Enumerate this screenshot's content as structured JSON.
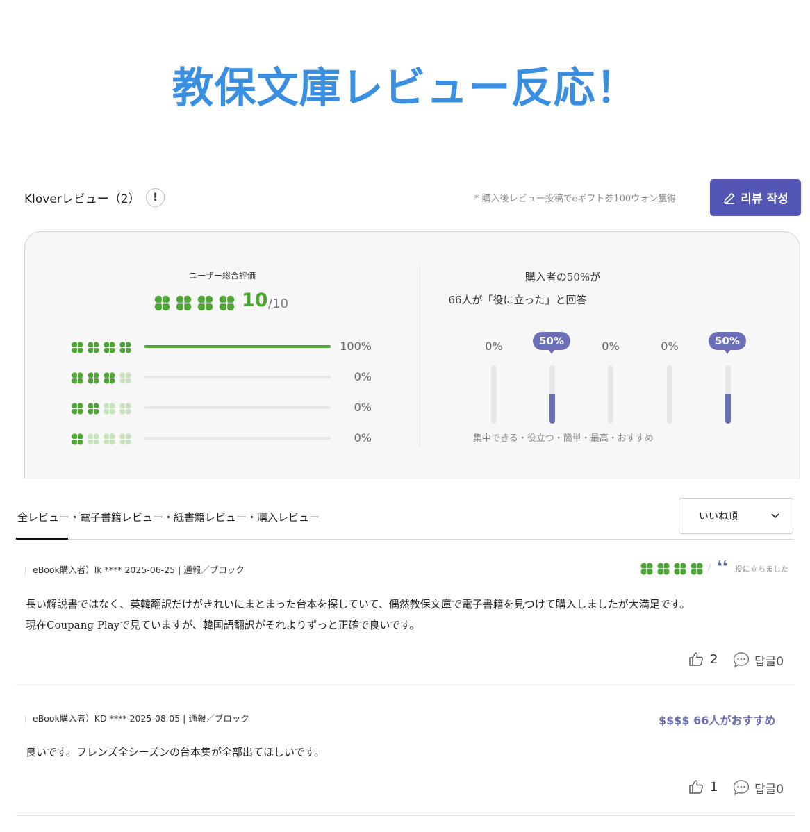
{
  "hero": {
    "title": "教保文庫レビュー反応！"
  },
  "header": {
    "section_title": "Kloverレビュー（2）",
    "info_icon_glyph": "!",
    "reward_note": "* 購入後レビュー投稿でeギフト券100ウォン獲得",
    "write_button_label": "리뷰 작성",
    "write_button_icon": "pencil-icon"
  },
  "summary": {
    "rating_label": "ユーザー総合評価",
    "score": "10",
    "score_max": "/10",
    "clover_count": 4,
    "distribution": [
      {
        "filled": 4,
        "percent": 100,
        "label": "100%"
      },
      {
        "filled": 3,
        "percent": 0,
        "label": "0%"
      },
      {
        "filled": 2,
        "percent": 0,
        "label": "0%"
      },
      {
        "filled": 1,
        "percent": 0,
        "label": "0%"
      }
    ],
    "buyer_line1": "購入者の50%が",
    "buyer_line2": "66人が「役に立った」と回答",
    "keywords": [
      {
        "label": "0%",
        "percent": 0,
        "highlighted": false
      },
      {
        "label": "50%",
        "percent": 50,
        "highlighted": true
      },
      {
        "label": "0%",
        "percent": 0,
        "highlighted": false
      },
      {
        "label": "0%",
        "percent": 0,
        "highlighted": false
      },
      {
        "label": "50%",
        "percent": 50,
        "highlighted": true
      }
    ],
    "keyword_labels": "集中できる・役立つ・簡単・最高・おすすめ"
  },
  "tabs": {
    "filter_text": "全レビュー・電子書籍レビュー・紙書籍レビュー・購入レビュー",
    "sort_label": "いいね順"
  },
  "reviews": [
    {
      "meta": "eBook購入者）lk **** 2025-06-25 | 通報／ブロック",
      "rating_clovers": 4,
      "separator": "/",
      "quote_glyph": "❛❛",
      "helpful_label": "役に立ちました",
      "body_lines": [
        "長い解説書ではなく、英韓翻訳だけがきれいにまとまった台本を探していて、偶然教保文庫で電子書籍を見つけて購入しましたが大満足です。",
        "現在Coupang Playで見ていますが、韓国語翻訳がそれよりずっと正確で良いです。"
      ],
      "likes": "2",
      "replies": "답글0"
    },
    {
      "meta": "eBook購入者）KD **** 2025-08-05 | 通報／ブロック",
      "badge": "$$$$ 66人がおすすめ",
      "body_lines": [
        "良いです。フレンズ全シーズンの台本集が全部出てほしいです。"
      ],
      "likes": "1",
      "replies": "답글0"
    }
  ],
  "colors": {
    "hero": "#3a8fe0",
    "accent": "#5356b5",
    "keyword": "#6b6fb8",
    "clover_filled": "#4ea535",
    "clover_empty": "#c6e2b9"
  }
}
